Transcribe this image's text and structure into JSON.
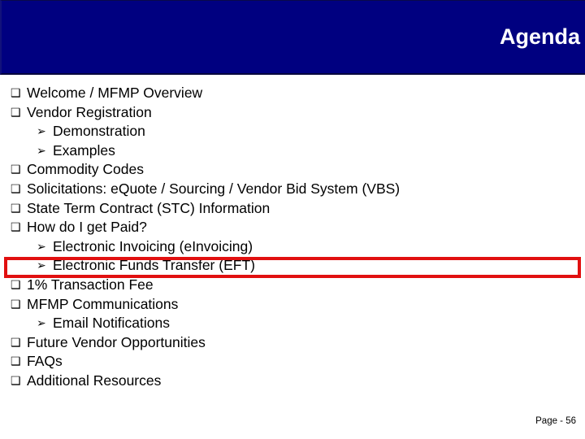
{
  "slide": {
    "title": "Agenda",
    "title_bar_color": "#000080",
    "title_text_color": "#FFFFFF",
    "background_color": "#FFFFFF",
    "highlight_color": "#E11010",
    "body_text_color": "#000000"
  },
  "bullets": {
    "level1_marker": "❑",
    "level2_marker": "➢",
    "items": [
      {
        "level": 1,
        "text": "Welcome / MFMP Overview",
        "highlighted": false
      },
      {
        "level": 1,
        "text": "Vendor Registration",
        "highlighted": false
      },
      {
        "level": 2,
        "text": "Demonstration",
        "highlighted": false
      },
      {
        "level": 2,
        "text": "Examples",
        "highlighted": false
      },
      {
        "level": 1,
        "text": "Commodity Codes",
        "highlighted": false
      },
      {
        "level": 1,
        "text": "Solicitations: eQuote / Sourcing / Vendor Bid System (VBS)",
        "highlighted": false
      },
      {
        "level": 1,
        "text": "State Term Contract (STC) Information",
        "highlighted": false
      },
      {
        "level": 1,
        "text": "How do I get Paid?",
        "highlighted": false
      },
      {
        "level": 2,
        "text": "Electronic Invoicing (eInvoicing)",
        "highlighted": false
      },
      {
        "level": 2,
        "text": "Electronic Funds Transfer (EFT)",
        "highlighted": true
      },
      {
        "level": 1,
        "text": "1% Transaction Fee",
        "highlighted": false
      },
      {
        "level": 1,
        "text": "MFMP Communications",
        "highlighted": false
      },
      {
        "level": 2,
        "text": "Email Notifications",
        "highlighted": false
      },
      {
        "level": 1,
        "text": "Future Vendor Opportunities",
        "highlighted": false
      },
      {
        "level": 1,
        "text": "FAQs",
        "highlighted": false
      },
      {
        "level": 1,
        "text": "Additional Resources",
        "highlighted": false
      }
    ]
  },
  "footer": {
    "page_label": "Page - 56"
  }
}
